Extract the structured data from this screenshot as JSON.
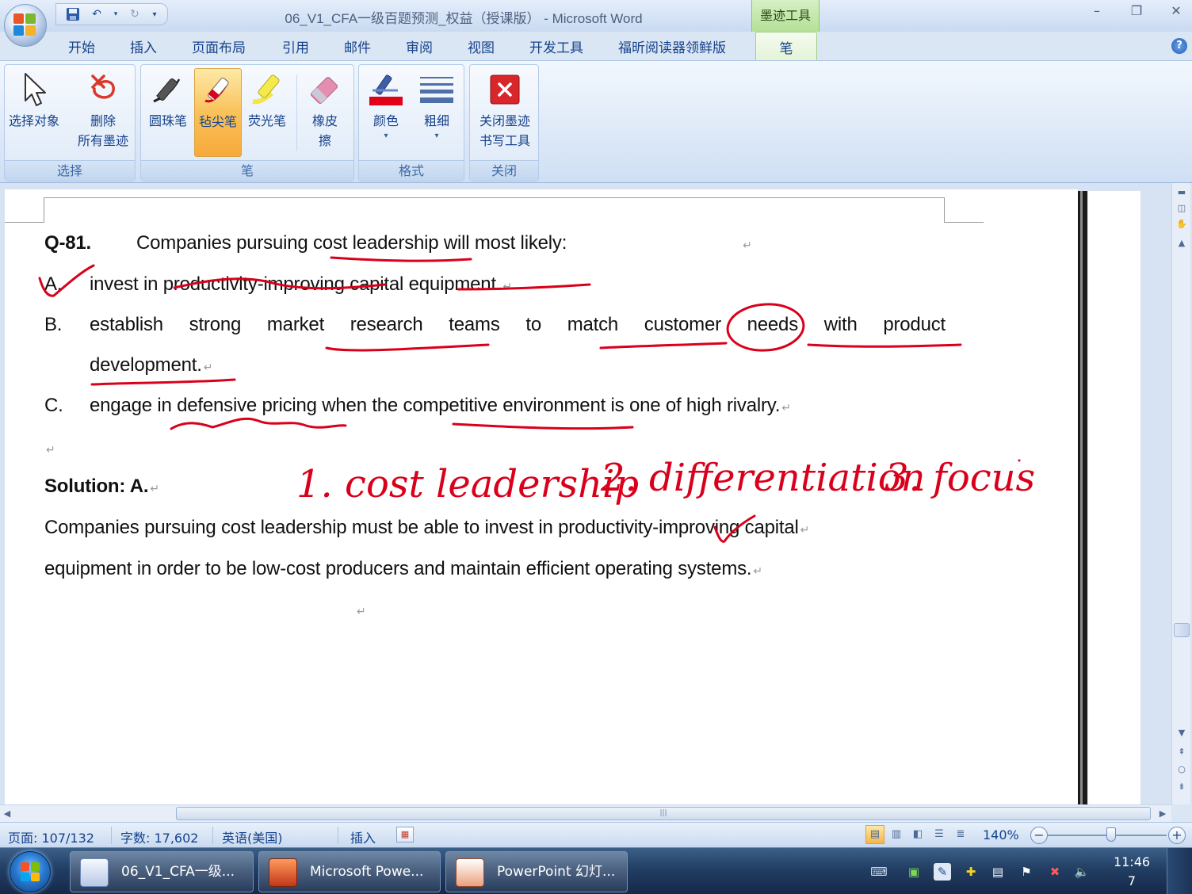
{
  "window": {
    "title": "06_V1_CFA一级百题预测_权益（授课版） - Microsoft Word",
    "context_tab_title": "墨迹工具"
  },
  "tabs": [
    "开始",
    "插入",
    "页面布局",
    "引用",
    "邮件",
    "审阅",
    "视图",
    "开发工具",
    "福昕阅读器领鲜版"
  ],
  "active_tab": "笔",
  "ribbon": {
    "select_group": {
      "label": "选择",
      "select_objects": "选择对象",
      "delete_all_ink_line1": "删除",
      "delete_all_ink_line2": "所有墨迹"
    },
    "pen_group": {
      "label": "笔",
      "ballpoint": "圆珠笔",
      "felt_tip": "毡尖笔",
      "highlighter": "荧光笔",
      "eraser_line1": "橡皮",
      "eraser_line2": "擦"
    },
    "format_group": {
      "label": "格式",
      "color": "颜色",
      "thickness": "粗细"
    },
    "close_group": {
      "label": "关闭",
      "close_ink_line1": "关闭墨迹",
      "close_ink_line2": "书写工具"
    }
  },
  "document": {
    "question_number": "Q-81.",
    "question_text": "Companies pursuing cost leadership will most likely:",
    "options": [
      {
        "letter": "A.",
        "text": "invest in productivity-improving capital equipment."
      },
      {
        "letter": "B.",
        "text": "establish strong market research teams to match customer needs with product",
        "text2": "development."
      },
      {
        "letter": "C.",
        "text": "engage in defensive pricing when the competitive environment is one of high rivalry."
      }
    ],
    "solution_label": "Solution: A.",
    "solution_line1": "Companies pursuing cost leadership must be able to invest in productivity-improving capital",
    "solution_line2": "equipment in order to be low-cost producers and maintain efficient operating systems.",
    "ink_notes": {
      "note1": "1. cost leadership",
      "note2": "2. differentiation",
      "note3": "3. focus"
    }
  },
  "statusbar": {
    "page": "页面: 107/132",
    "word_count": "字数: 17,602",
    "language": "英语(美国)",
    "insert_mode": "插入",
    "zoom": "140%"
  },
  "taskbar": {
    "tasks": [
      "06_V1_CFA一级...",
      "Microsoft Powe...",
      "PowerPoint 幻灯..."
    ],
    "clock_time": "11:46",
    "clock_extra": "7"
  },
  "colors": {
    "ink": "#d9001b",
    "ribbon_blue": "#15428b",
    "active_pen": "#f7b44a"
  }
}
